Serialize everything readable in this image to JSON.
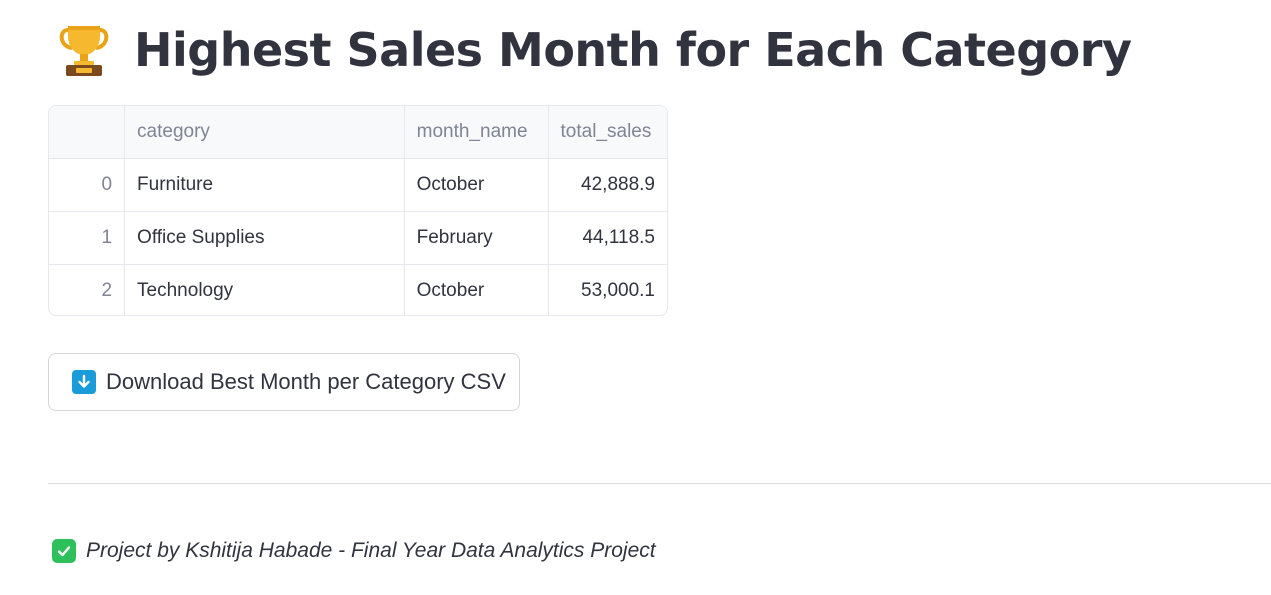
{
  "header": {
    "title": "Highest Sales Month for Each Category",
    "icon": "trophy-icon"
  },
  "table": {
    "columns": [
      "",
      "category",
      "month_name",
      "total_sales"
    ],
    "rows": [
      {
        "index": "0",
        "category": "Furniture",
        "month_name": "October",
        "total_sales": "42,888.9"
      },
      {
        "index": "1",
        "category": "Office Supplies",
        "month_name": "February",
        "total_sales": "44,118.5"
      },
      {
        "index": "2",
        "category": "Technology",
        "month_name": "October",
        "total_sales": "53,000.1"
      }
    ]
  },
  "download": {
    "label": "Download Best Month per Category CSV",
    "icon": "down-arrow-icon"
  },
  "footer": {
    "text": "Project by Kshitija Habade - Final Year Data Analytics Project",
    "icon": "check-mark-icon"
  },
  "colors": {
    "text": "#31333f",
    "muted": "#808495",
    "download_icon_bg": "#1a9cdb",
    "check_icon_bg": "#2ec05a"
  }
}
